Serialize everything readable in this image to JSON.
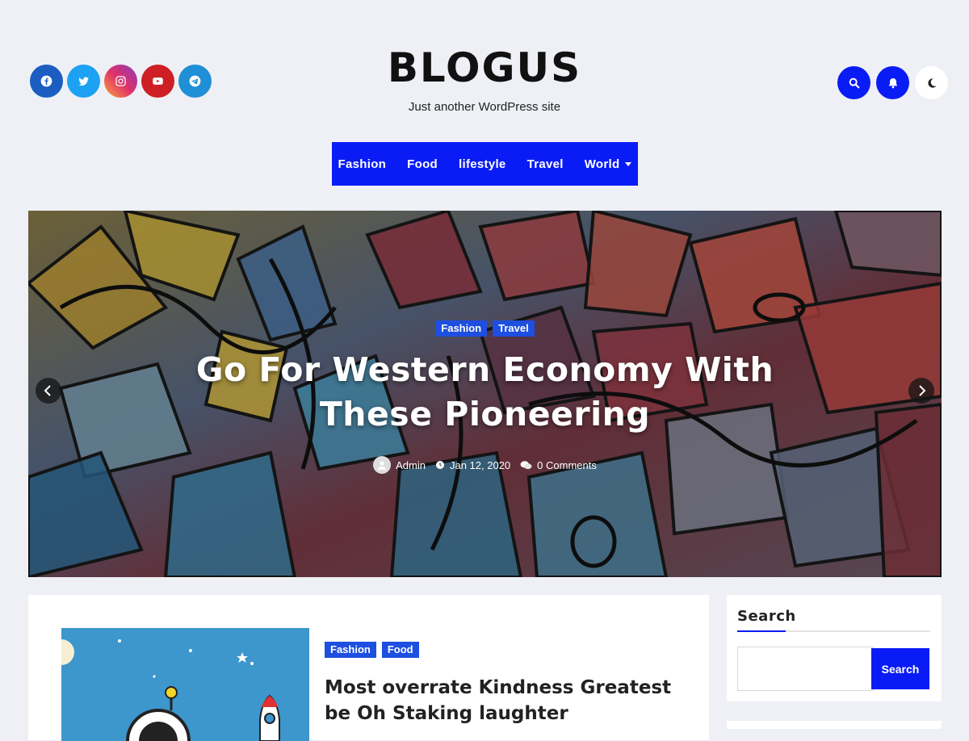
{
  "colors": {
    "accent": "#0a1cf5",
    "page_bg": "#eef0f6",
    "facebook": "#1b5dc0",
    "twitter": "#1da1f2",
    "instagram": "#d6286f",
    "youtube": "#cd1f24",
    "telegram": "#1f8fd6",
    "tag": "#1d4fe0"
  },
  "social": [
    {
      "name": "facebook-icon"
    },
    {
      "name": "twitter-icon"
    },
    {
      "name": "instagram-icon"
    },
    {
      "name": "youtube-icon"
    },
    {
      "name": "telegram-icon"
    }
  ],
  "site": {
    "title": "BLOGUS",
    "tagline": "Just another WordPress site"
  },
  "header_actions": {
    "search_icon": "search-icon",
    "bell_icon": "bell-icon",
    "theme_icon": "moon-icon"
  },
  "nav": {
    "items": [
      "Fashion",
      "Food",
      "lifestyle",
      "Travel",
      "World"
    ]
  },
  "hero": {
    "categories": [
      "Fashion",
      "Travel"
    ],
    "title": "Go For Western Economy With These Pioneering",
    "author": "Admin",
    "date": "Jan 12, 2020",
    "comments": "0 Comments"
  },
  "post": {
    "categories": [
      "Fashion",
      "Food"
    ],
    "title": "Most overrate Kindness Greatest be Oh Staking laughter"
  },
  "sidebar": {
    "search_title": "Search",
    "search_button": "Search",
    "search_placeholder": ""
  }
}
